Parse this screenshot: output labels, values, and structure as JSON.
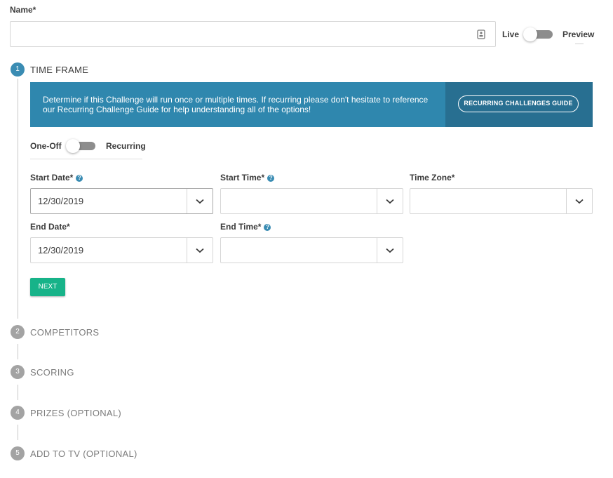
{
  "name": {
    "label": "Name*",
    "value": "",
    "placeholder": ""
  },
  "publish_toggle": {
    "left": "Live",
    "right": "Preview"
  },
  "steps": [
    {
      "number": "1",
      "label": "TIME FRAME",
      "state": "active"
    },
    {
      "number": "2",
      "label": "COMPETITORS",
      "state": "inactive"
    },
    {
      "number": "3",
      "label": "SCORING",
      "state": "inactive"
    },
    {
      "number": "4",
      "label": "PRIZES (OPTIONAL)",
      "state": "inactive"
    },
    {
      "number": "5",
      "label": "ADD TO TV (OPTIONAL)",
      "state": "inactive"
    }
  ],
  "banner": {
    "text": "Determine if this Challenge will run once or multiple times. If recurring please don't hesitate to reference our Recurring Challenge Guide for help understanding all of the options!",
    "button": "RECURRING CHALLENGES GUIDE"
  },
  "frequency_toggle": {
    "left": "One-Off",
    "right": "Recurring"
  },
  "fields": {
    "start_date": {
      "label": "Start Date*",
      "value": "12/30/2019"
    },
    "start_time": {
      "label": "Start Time*",
      "value": ""
    },
    "time_zone": {
      "label": "Time Zone*",
      "value": ""
    },
    "end_date": {
      "label": "End Date*",
      "value": "12/30/2019"
    },
    "end_time": {
      "label": "End Time*",
      "value": ""
    }
  },
  "next_button": "NEXT",
  "icons": {
    "help": "help-icon",
    "caret": "chevron-down-icon",
    "contact": "contact-card-icon"
  },
  "colors": {
    "accent": "#2f87ae",
    "banner_dark": "#286f91",
    "next": "#17b389",
    "step_active": "#3a8cb3",
    "step_inactive": "#a3a3a3"
  }
}
